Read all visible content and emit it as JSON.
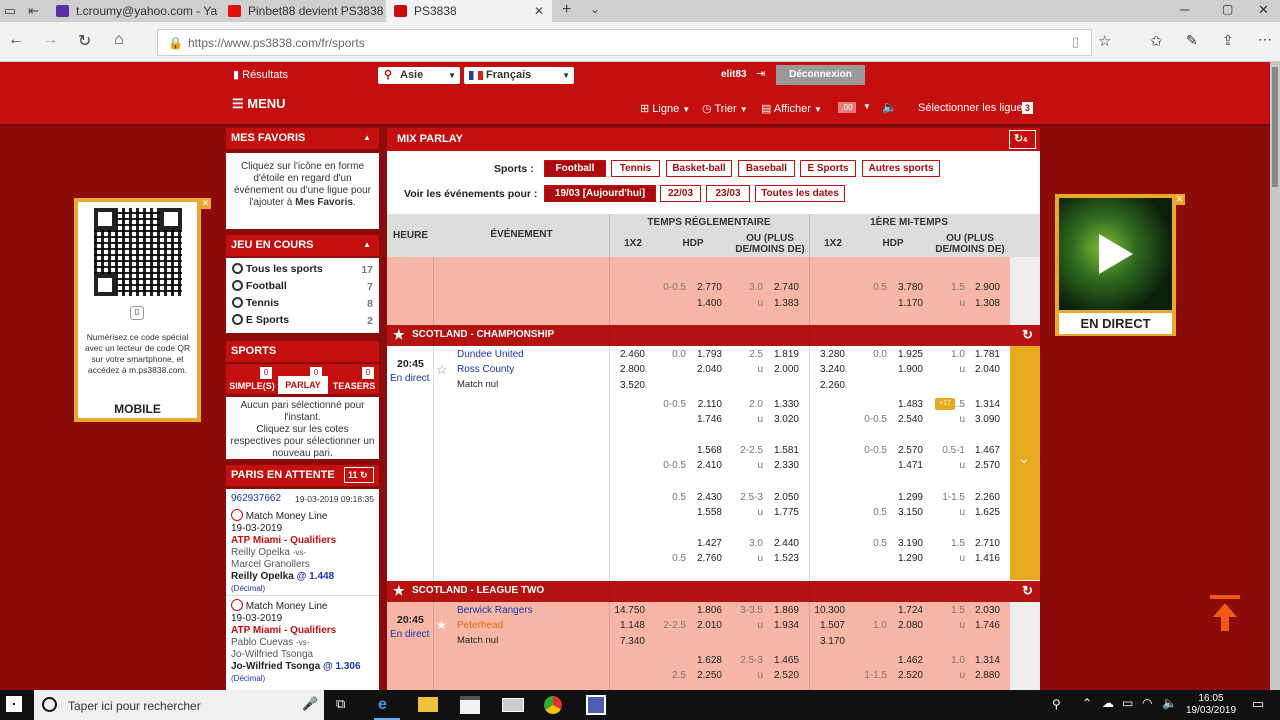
{
  "browser": {
    "tabs": [
      {
        "title": "t.croumy@yahoo.com - Yah",
        "color": "#5f2eaa"
      },
      {
        "title": "Pinbet88 devient PS3838 | F",
        "color": "#e01010"
      },
      {
        "title": "PS3838",
        "color": "#c40f0f"
      }
    ],
    "url": "https://www.ps3838.com/fr/sports"
  },
  "site": {
    "resultats": "Résultats",
    "region": "Asie",
    "language": "Français",
    "username": "elit83",
    "logout": "Déconnexion",
    "menu": "MENU",
    "toolbar": {
      "ligne": "Ligne",
      "trier": "Trier",
      "afficher": "Afficher",
      "odds_fmt": ".00",
      "select_lines": "Sélectionner les ligues",
      "select_count": "3"
    }
  },
  "favoris": {
    "title": "MES FAVORIS",
    "text": "Cliquez sur l'icône en forme d'étoile en regard d'un événement ou d'une ligue pour l'ajouter à",
    "bold": "Mes Favoris",
    "end": "."
  },
  "qr": {
    "text": "Numérisez ce code spécial avec un lecteur de code QR sur votre smartphone, et accédez à m.ps3838.com.",
    "label": "MOBILE"
  },
  "en_cours": {
    "title": "JEU EN COURS",
    "items": [
      {
        "label": "Tous les sports",
        "count": "17"
      },
      {
        "label": "Football",
        "count": "7"
      },
      {
        "label": "Tennis",
        "count": "8"
      },
      {
        "label": "E Sports",
        "count": "2"
      }
    ]
  },
  "sports_panel": {
    "title": "SPORTS",
    "tabs": [
      {
        "label": "SIMPLE(S)",
        "badge": "0"
      },
      {
        "label": "PARLAY",
        "badge": "0"
      },
      {
        "label": "TEASERS",
        "badge": "0"
      }
    ],
    "empty1": "Aucun pari sélectionné pour l'instant.",
    "empty2": "Cliquez sur les cotes respectives pour sélectionner un nouveau pari."
  },
  "attente": {
    "title": "PARIS EN ATTENTE",
    "count": "11",
    "bet_id": "962937662",
    "bet_date": "19-03-2019 09:18:35",
    "bets": [
      {
        "type": "Match Money Line",
        "date": "19-03-2019",
        "league": "ATP Miami - Qualifiers",
        "p1": "Reilly Opelka",
        "vs": "-vs-",
        "p2": "Marcel Granollers",
        "pick": "Reilly Opelka",
        "at": "@",
        "odds": "1.448",
        "fmt": "(Décimal)"
      },
      {
        "type": "Match Money Line",
        "date": "19-03-2019",
        "league": "ATP Miami - Qualifiers",
        "p1": "Pablo Cuevas",
        "vs": "-vs-",
        "p2": "Jo-Wilfried Tsonga",
        "pick": "Jo-Wilfried Tsonga",
        "at": "@",
        "odds": "1.306",
        "fmt": "(Décimal)"
      }
    ]
  },
  "main": {
    "title": "MIX PARLAY",
    "refresh_count": "4",
    "sports_label": "Sports :",
    "sports": [
      "Football",
      "Tennis",
      "Basket-ball",
      "Baseball",
      "E Sports",
      "Autres sports"
    ],
    "events_label": "Voir les événements pour :",
    "dates": [
      "19/03 [Aujourd'hui]",
      "22/03",
      "23/03",
      "Toutes les dates"
    ],
    "headers": {
      "heure": "HEURE",
      "evenement": "ÉVÉNEMENT",
      "temps": "TEMPS RÉGLEMENTAIRE",
      "mitemps": "1ÈRE MI-TEMPS",
      "x12": "1X2",
      "hdp": "HDP",
      "ou1": "OU (PLUS",
      "ou2": "DE/MOINS DE)"
    },
    "top_rows": [
      [
        "",
        "0-0.5",
        "2.770",
        "3.0",
        "2.740",
        "",
        "0.5",
        "3.780",
        "1.5",
        "2.900"
      ],
      [
        "",
        "",
        "1.400",
        "u",
        "1.383",
        "",
        "",
        "1.170",
        "u",
        "1.308"
      ]
    ],
    "league1": "SCOTLAND - CHAMPIONSHIP",
    "match1": {
      "time": "20:45",
      "status": "En direct",
      "home": "Dundee United",
      "away": "Ross County",
      "draw": "Match nul",
      "rows": [
        [
          "2.460",
          "0.0",
          "1.793",
          "2.5",
          "1.819",
          "3.280",
          "0.0",
          "1.925",
          "1.0",
          "1.781"
        ],
        [
          "2.800",
          "",
          "2.040",
          "u",
          "2.000",
          "3.240",
          "",
          "1.900",
          "u",
          "2.040"
        ],
        [
          "3.520",
          "",
          "",
          "",
          "",
          "2.260",
          "",
          "",
          "",
          ""
        ],
        [
          "",
          "0-0.5",
          "2.110",
          "2.0",
          "1.330",
          "",
          "",
          "1.483",
          "1.5",
          "1.314"
        ],
        [
          "",
          "",
          "1.746",
          "u",
          "3.020",
          "",
          "0-0.5",
          "2.540",
          "u",
          "3.090"
        ],
        [
          "",
          "",
          "1.568",
          "2-2.5",
          "1.581",
          "",
          "0-0.5",
          "2.570",
          "0.5-1",
          "1.467"
        ],
        [
          "",
          "0-0.5",
          "2.410",
          "u",
          "2.330",
          "",
          "",
          "1.471",
          "u",
          "2.570"
        ],
        [
          "",
          "0.5",
          "2.430",
          "2.5-3",
          "2.050",
          "",
          "",
          "1.299",
          "1-1.5",
          "2.260"
        ],
        [
          "",
          "",
          "1.558",
          "u",
          "1.775",
          "",
          "0.5",
          "3.150",
          "u",
          "1.625"
        ],
        [
          "",
          "",
          "1.427",
          "3.0",
          "2.440",
          "",
          "0.5",
          "3.190",
          "1.5",
          "2.710"
        ],
        [
          "",
          "0.5",
          "2.760",
          "u",
          "1.523",
          "",
          "",
          "1.290",
          "u",
          "1.416"
        ]
      ],
      "more_badge": "+17"
    },
    "league2": "SCOTLAND - LEAGUE TWO",
    "match2": {
      "time": "20:45",
      "status": "En direct",
      "home": "Berwick Rangers",
      "away": "Peterhead",
      "draw": "Match nul",
      "rows": [
        [
          "14.750",
          "",
          "1.806",
          "3-3.5",
          "1.869",
          "10.300",
          "",
          "1.724",
          "1.5",
          "2.030"
        ],
        [
          "1.148",
          "2-2.5",
          "2.010",
          "u",
          "1.934",
          "1.507",
          "1.0",
          "2.080",
          "u",
          "1.746"
        ],
        [
          "7.340",
          "",
          "",
          "",
          "",
          "3.170",
          "",
          "",
          "",
          ""
        ],
        [
          "",
          "",
          "1.628",
          "2.5-3",
          "1.465",
          "",
          "",
          "1.462",
          "1.0",
          "1.314"
        ],
        [
          "",
          "2.5",
          "2.250",
          "u",
          "2.520",
          "",
          "1-1.5",
          "2.520",
          "u",
          "2.880"
        ]
      ]
    }
  },
  "live": {
    "label": "EN DIRECT"
  },
  "taskbar": {
    "search": "Taper ici pour rechercher",
    "time": "16:05",
    "date": "19/03/2019"
  }
}
